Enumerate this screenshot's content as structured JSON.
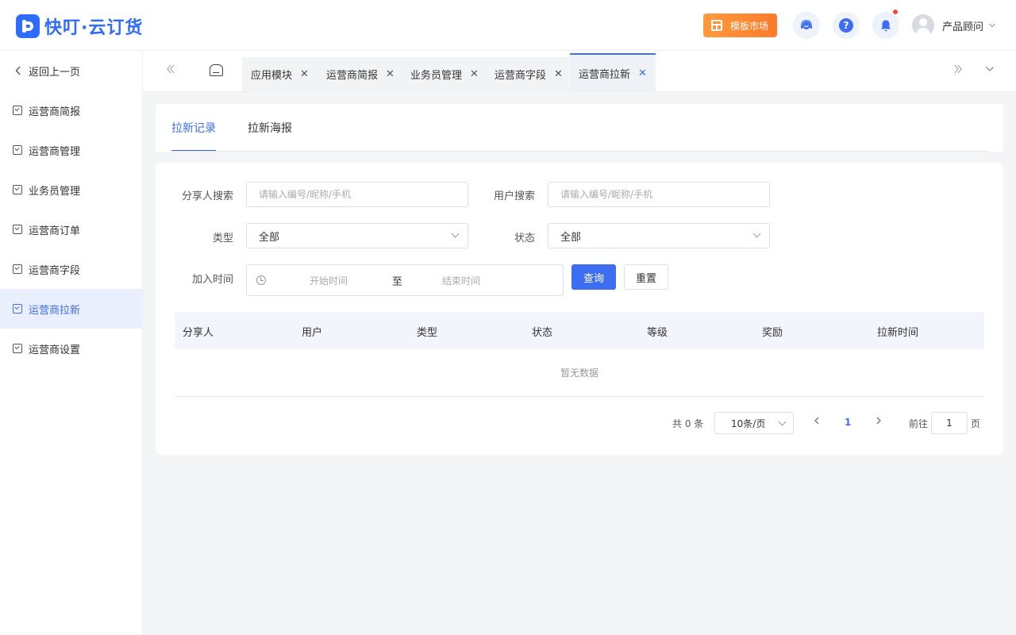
{
  "app": {
    "logo_text": "快叮·云订货"
  },
  "header": {
    "market_label": "模板市场",
    "user_name": "产品顾问"
  },
  "sidebar": {
    "back_label": "返回上一页",
    "items": [
      {
        "label": "运营商简报"
      },
      {
        "label": "运营商管理"
      },
      {
        "label": "业务员管理"
      },
      {
        "label": "运营商订单"
      },
      {
        "label": "运营商字段"
      },
      {
        "label": "运营商拉新",
        "active": true
      },
      {
        "label": "运营商设置"
      }
    ]
  },
  "tabs": [
    {
      "label": "应用模块"
    },
    {
      "label": "运营商简报"
    },
    {
      "label": "业务员管理"
    },
    {
      "label": "运营商字段"
    },
    {
      "label": "运营商拉新",
      "active": true
    }
  ],
  "content_tabs": [
    {
      "label": "拉新记录",
      "active": true
    },
    {
      "label": "拉新海报"
    }
  ],
  "filters": {
    "sharer_label": "分享人搜索",
    "sharer_placeholder": "请输入编号/昵称/手机",
    "user_label": "用户搜索",
    "user_placeholder": "请输入编号/昵称/手机",
    "type_label": "类型",
    "type_value": "全部",
    "status_label": "状态",
    "status_value": "全部",
    "join_time_label": "加入时间",
    "start_placeholder": "开始时间",
    "range_separator": "至",
    "end_placeholder": "结束时间",
    "query_button": "查询",
    "reset_button": "重置"
  },
  "table": {
    "columns": [
      "分享人",
      "用户",
      "类型",
      "状态",
      "等级",
      "奖励",
      "拉新时间"
    ],
    "rows": [],
    "empty_text": "暂无数据"
  },
  "pagination": {
    "total_text": "共 0 条",
    "page_size": "10条/页",
    "current_page": "1",
    "goto_prefix": "前往",
    "goto_value": "1",
    "goto_suffix": "页"
  },
  "colors": {
    "primary": "#3d6df0",
    "brand": "#2f6bff",
    "market": "#ff8a33",
    "notification_dot": "#f5493c"
  },
  "icons": [
    "logo-icon",
    "market-icon",
    "service-icon",
    "help-icon",
    "bell-icon",
    "avatar",
    "chevron-down-icon",
    "back-chevron-icon",
    "menu-check-icon",
    "double-left-icon",
    "home-icon",
    "close-icon",
    "double-right-icon",
    "clock-icon",
    "chevron-left-icon",
    "chevron-right-icon"
  ]
}
